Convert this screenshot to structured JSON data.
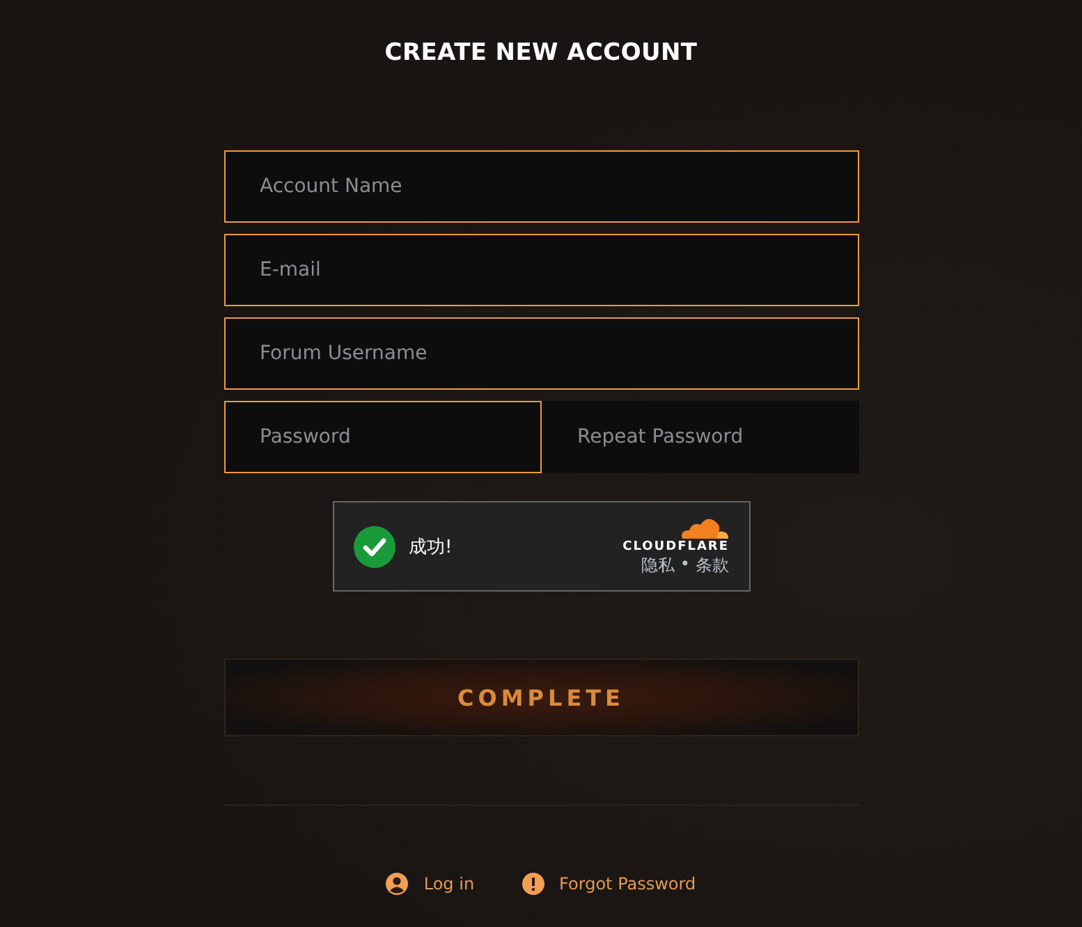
{
  "title": "CREATE NEW ACCOUNT",
  "fields": [
    {
      "placeholder": "Account Name",
      "highlighted": true
    },
    {
      "placeholder": "E-mail",
      "highlighted": true
    },
    {
      "placeholder": "Forum Username",
      "highlighted": true
    }
  ],
  "password_row": [
    {
      "placeholder": "Password",
      "highlighted": true
    },
    {
      "placeholder": "Repeat Password",
      "highlighted": false
    }
  ],
  "captcha": {
    "status": "成功!",
    "brand": "CLOUDFLARE",
    "privacy": "隐私",
    "separator": "•",
    "terms": "条款"
  },
  "submit": "COMPLETE",
  "links": [
    {
      "label": "Log in",
      "kind": "user"
    },
    {
      "label": "Forgot Password",
      "kind": "alert"
    }
  ]
}
